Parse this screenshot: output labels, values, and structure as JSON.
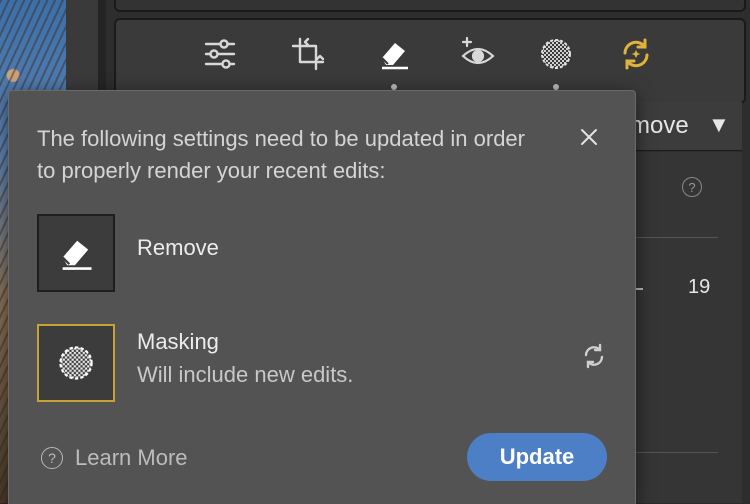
{
  "toolbar": {
    "tools": [
      {
        "name": "edit-sliders-icon"
      },
      {
        "name": "crop-icon"
      },
      {
        "name": "eraser-icon"
      },
      {
        "name": "red-eye-icon"
      },
      {
        "name": "masking-icon"
      },
      {
        "name": "sync-icon",
        "color": "#e0b43a"
      }
    ]
  },
  "side_panel": {
    "title": "move",
    "slider_value": "19"
  },
  "dialog": {
    "message": "The following settings need to be updated in order to properly render your recent edits:",
    "items": [
      {
        "title": "Remove",
        "subtitle": "",
        "icon": "eraser-icon"
      },
      {
        "title": "Masking",
        "subtitle": "Will include new edits.",
        "icon": "masking-icon"
      }
    ],
    "learn_more": "Learn More",
    "update_label": "Update"
  },
  "colors": {
    "accent": "#4c7fc6",
    "highlight_border": "#c9a233",
    "dialog_bg": "#535353"
  }
}
